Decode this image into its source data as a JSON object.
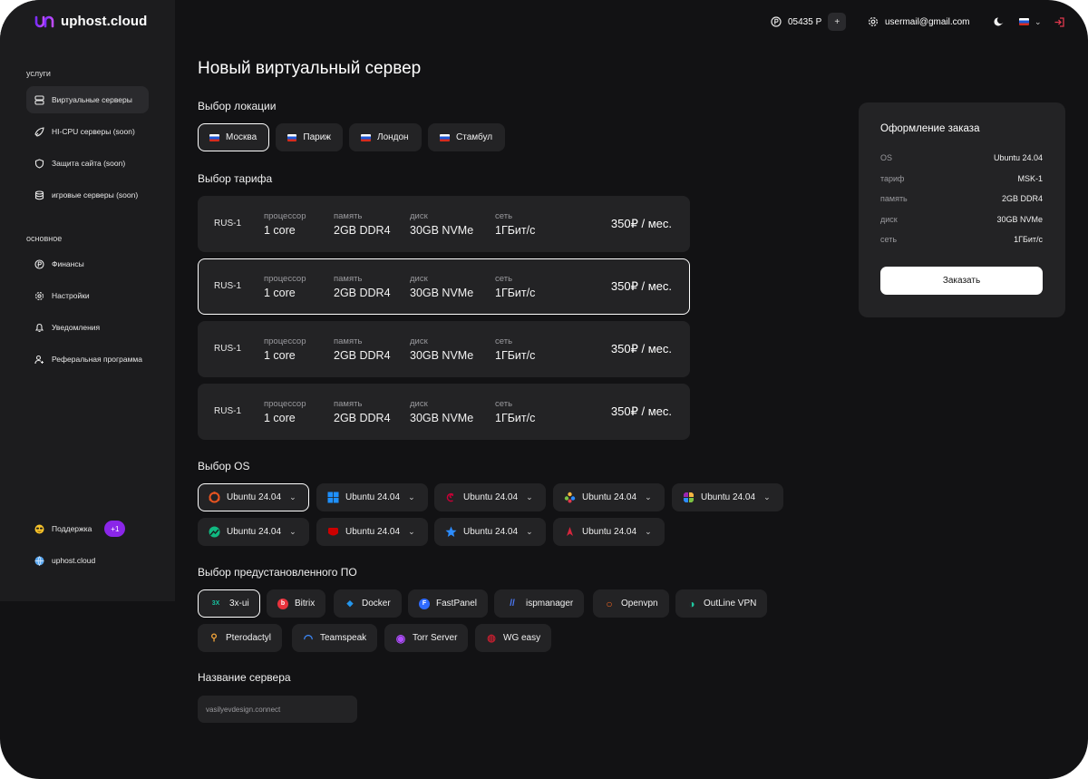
{
  "brand": {
    "name": "uphost.cloud"
  },
  "sidebar": {
    "section_services": "услуги",
    "section_main": "основное",
    "services": [
      {
        "label": "Виртуальные серверы",
        "icon": "server-icon"
      },
      {
        "label": "HI-CPU серверы (soon)",
        "icon": "rocket-icon"
      },
      {
        "label": "Защита сайта (soon)",
        "icon": "shield-icon"
      },
      {
        "label": "игровые серверы (soon)",
        "icon": "database-icon"
      }
    ],
    "main": [
      {
        "label": "Финансы",
        "icon": "ruble-coin-icon"
      },
      {
        "label": "Настройки",
        "icon": "gear-icon"
      },
      {
        "label": "Уведомления",
        "icon": "bell-icon"
      },
      {
        "label": "Реферальная программа",
        "icon": "user-plus-icon"
      }
    ],
    "support_label": "Поддержка",
    "support_badge": "+1",
    "support_icon": "sunglasses-emoji-icon",
    "site_label": "uphost.cloud",
    "site_icon": "globe-icon"
  },
  "topbar": {
    "balance": "05435 Р",
    "add_label": "+",
    "email": "usermail@gmail.com"
  },
  "page": {
    "title": "Новый виртуальный сервер",
    "location_title": "Выбор локации",
    "tariff_title": "Выбор тарифа",
    "os_title": "Выбор OS",
    "software_title": "Выбор предустановленного ПО",
    "server_name_title": "Название сервера"
  },
  "locations": [
    "Москва",
    "Париж",
    "Лондон",
    "Стамбул"
  ],
  "tariff_labels": {
    "cpu": "процессор",
    "memory": "память",
    "disk": "диск",
    "network": "сеть"
  },
  "tariffs": [
    {
      "name": "RUS-1",
      "cpu": "1 core",
      "memory": "2GB DDR4",
      "disk": "30GB NVMe",
      "network": "1ГБит/с",
      "price": "350₽ / мес."
    },
    {
      "name": "RUS-1",
      "cpu": "1 core",
      "memory": "2GB DDR4",
      "disk": "30GB NVMe",
      "network": "1ГБит/с",
      "price": "350₽ / мес."
    },
    {
      "name": "RUS-1",
      "cpu": "1 core",
      "memory": "2GB DDR4",
      "disk": "30GB NVMe",
      "network": "1ГБит/с",
      "price": "350₽ / мес."
    },
    {
      "name": "RUS-1",
      "cpu": "1 core",
      "memory": "2GB DDR4",
      "disk": "30GB NVMe",
      "network": "1ГБит/с",
      "price": "350₽ / мес."
    }
  ],
  "os_options": [
    {
      "label": "Ubuntu 24.04",
      "icon": "ubuntu-icon",
      "color": "#e95420"
    },
    {
      "label": "Ubuntu 24.04",
      "icon": "windows-icon",
      "color": "#1e90ff"
    },
    {
      "label": "Ubuntu 24.04",
      "icon": "debian-icon",
      "color": "#c70036"
    },
    {
      "label": "Ubuntu 24.04",
      "icon": "almalinux-icon",
      "color": "#f5b642"
    },
    {
      "label": "Ubuntu 24.04",
      "icon": "centos-icon",
      "color": "#9c27b0"
    },
    {
      "label": "Ubuntu 24.04",
      "icon": "rocky-linux-icon",
      "color": "#10b981"
    },
    {
      "label": "Ubuntu 24.04",
      "icon": "redhat-icon",
      "color": "#cc0000"
    },
    {
      "label": "Ubuntu 24.04",
      "icon": "star-icon",
      "color": "#2c8cff"
    },
    {
      "label": "Ubuntu 24.04",
      "icon": "arch-icon",
      "color": "#d7263d"
    }
  ],
  "software": [
    {
      "label": "3x-ui",
      "icon": "3x-ui-icon",
      "color": "#18c2a0",
      "glyph": "3X"
    },
    {
      "label": "Bitrix",
      "icon": "bitrix-icon",
      "color": "#e8323c",
      "glyph": "b"
    },
    {
      "label": "Docker",
      "icon": "docker-icon",
      "color": "#2496ed",
      "glyph": "◆"
    },
    {
      "label": "FastPanel",
      "icon": "fastpanel-icon",
      "color": "#2f6bff",
      "glyph": "F"
    },
    {
      "label": "ispmanager",
      "icon": "ispmanager-icon",
      "color": "#4d7cff",
      "glyph": "//"
    },
    {
      "label": "Openvpn",
      "icon": "openvpn-icon",
      "color": "#f26522",
      "glyph": "○"
    },
    {
      "label": "OutLine VPN",
      "icon": "outline-vpn-icon",
      "color": "#1fc8a0",
      "glyph": "◑"
    },
    {
      "label": "Pterodactyl",
      "icon": "pterodactyl-icon",
      "color": "#f0a33a",
      "glyph": "⚲"
    },
    {
      "label": "Teamspeak",
      "icon": "teamspeak-icon",
      "color": "#3d8bff",
      "glyph": "◠"
    },
    {
      "label": "Torr Server",
      "icon": "torr-server-icon",
      "color": "#b04dff",
      "glyph": "◉"
    },
    {
      "label": "WG easy",
      "icon": "wg-easy-icon",
      "color": "#c01f2f",
      "glyph": "◍"
    }
  ],
  "server_name": {
    "placeholder": "vasilyevdesign.connect"
  },
  "order": {
    "title": "Оформление заказа",
    "rows": [
      {
        "key": "OS",
        "value": "Ubuntu 24.04"
      },
      {
        "key": "тариф",
        "value": "MSK-1"
      },
      {
        "key": "память",
        "value": "2GB DDR4"
      },
      {
        "key": "диск",
        "value": "30GB NVMe"
      },
      {
        "key": "сеть",
        "value": "1ГБит/с"
      }
    ],
    "button_label": "Заказать"
  },
  "colors": {
    "background": "#121214",
    "surface": "#232325",
    "sidebar": "#1c1c1e",
    "accent": "#8a26e8",
    "logout": "#e0384d"
  }
}
